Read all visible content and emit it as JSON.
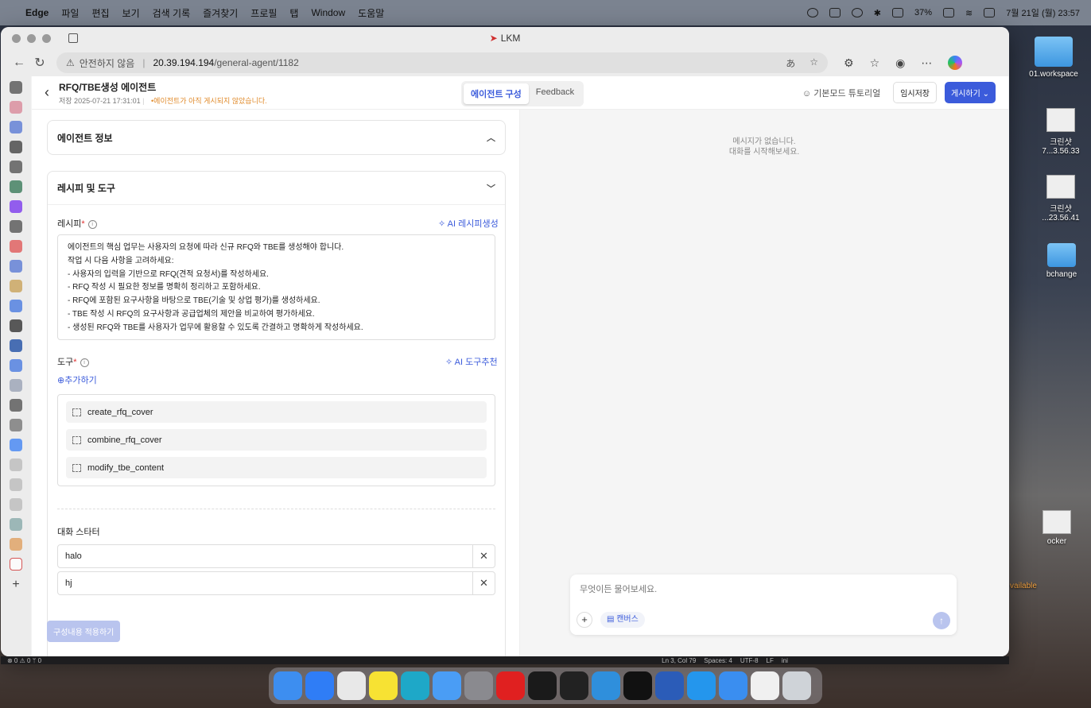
{
  "menubar": {
    "app": "Edge",
    "items": [
      "파일",
      "편집",
      "보기",
      "검색 기록",
      "즐겨찾기",
      "프로필",
      "탭",
      "Window",
      "도움말"
    ],
    "battery": "37%",
    "datetime": "7월 21일 (월) 23:57"
  },
  "desktop": {
    "items": [
      {
        "label": "01.workspace"
      },
      {
        "label": "크린샷\n7...3.56.33"
      },
      {
        "label": "크린샷\n...23.56.41"
      },
      {
        "label": "bchange"
      },
      {
        "label": "ocker"
      },
      {
        "label": "vailable"
      }
    ]
  },
  "window": {
    "title": "LKM"
  },
  "browser": {
    "insecure": "안전하지 않음",
    "host": "20.39.194.194",
    "path": "/general-agent/1182"
  },
  "app": {
    "title": "RFQ/TBE생성 에이전트",
    "saved": "저장 2025-07-21 17:31:01",
    "unpublished": "•에이전트가 아직 게시되지 않았습니다.",
    "tabs": [
      {
        "label": "에이전트 구성"
      },
      {
        "label": "Feedback"
      }
    ],
    "tutorial": "기본모드 튜토리얼",
    "save_draft": "임시저장",
    "publish": "게시하기"
  },
  "config": {
    "agent_info": "에이전트 정보",
    "recipe_tools": "레시피 및 도구",
    "recipe_label": "레시피",
    "ai_recipe": "AI 레시피생성",
    "recipe_lines": [
      "에이전트의 핵심 업무는 사용자의 요청에 따라 신규 RFQ와 TBE를 생성해야 합니다.",
      "작업 시 다음 사항을 고려하세요:",
      "- 사용자의 입력을 기반으로 RFQ(견적 요청서)를 작성하세요.",
      "- RFQ 작성 시 필요한 정보를 명확히 정리하고 포함하세요.",
      "- RFQ에 포함된 요구사항을 바탕으로 TBE(기술 및 상업 평가)를 생성하세요.",
      "- TBE 작성 시 RFQ의 요구사항과 공급업체의 제안을 비교하여 평가하세요.",
      "- 생성된 RFQ와 TBE를 사용자가 업무에 활용할 수 있도록 간결하고 명확하게 작성하세요."
    ],
    "tools_label": "도구",
    "ai_tools": "AI 도구추천",
    "add": "추가하기",
    "tools": [
      "create_rfq_cover",
      "combine_rfq_cover",
      "modify_tbe_content"
    ],
    "starter_label": "대화 스타터",
    "starters": [
      "halo",
      "hj"
    ],
    "apply": "구성내용 적용하기"
  },
  "chat": {
    "empty_line1": "메시지가 없습니다.",
    "empty_line2": "대화를 시작해보세요.",
    "placeholder": "무엇이든 물어보세요.",
    "canvas": "캔버스"
  },
  "vscode": {
    "left": "⊗ 0 ⚠ 0   ᛘ 0",
    "position": "Ln 3, Col 79",
    "spaces": "Spaces: 4",
    "encoding": "UTF-8",
    "eol": "LF",
    "lang": "ini"
  },
  "dock_apps": [
    {
      "name": "finder",
      "color": "#3d8ef0"
    },
    {
      "name": "app-store",
      "color": "#2f7df6"
    },
    {
      "name": "launchpad",
      "color": "#e8e8e8"
    },
    {
      "name": "kakaotalk",
      "color": "#f7e233"
    },
    {
      "name": "edge",
      "color": "#1ea8c8"
    },
    {
      "name": "mail",
      "color": "#4a9df5"
    },
    {
      "name": "settings",
      "color": "#8a8a8f"
    },
    {
      "name": "youtube",
      "color": "#e02020"
    },
    {
      "name": "netflix",
      "color": "#1a1a1a"
    },
    {
      "name": "terminal",
      "color": "#222222"
    },
    {
      "name": "vscode",
      "color": "#2f8fdc"
    },
    {
      "name": "cursor",
      "color": "#111111"
    },
    {
      "name": "word",
      "color": "#2b5cb8"
    },
    {
      "name": "docker",
      "color": "#2496ed"
    },
    {
      "name": "safari",
      "color": "#3a8ef0"
    },
    {
      "name": "document",
      "color": "#f0f0f0"
    },
    {
      "name": "trash",
      "color": "#cfd3d8"
    }
  ]
}
